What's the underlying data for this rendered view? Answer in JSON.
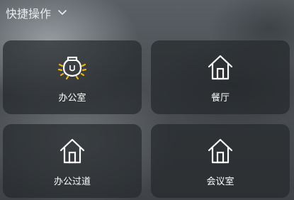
{
  "header": {
    "title": "快捷操作",
    "chevron_icon": "chevron-down-icon"
  },
  "colors": {
    "card_bg": "#26292d",
    "text": "#ffffff",
    "lamp_rays": "#f0b400"
  },
  "quick_actions": [
    {
      "label": "办公室",
      "icon": "lamp-on-icon",
      "active": true
    },
    {
      "label": "餐厅",
      "icon": "home-icon",
      "active": false
    },
    {
      "label": "办公过道",
      "icon": "home-icon",
      "active": false
    },
    {
      "label": "会议室",
      "icon": "home-icon",
      "active": false
    }
  ]
}
